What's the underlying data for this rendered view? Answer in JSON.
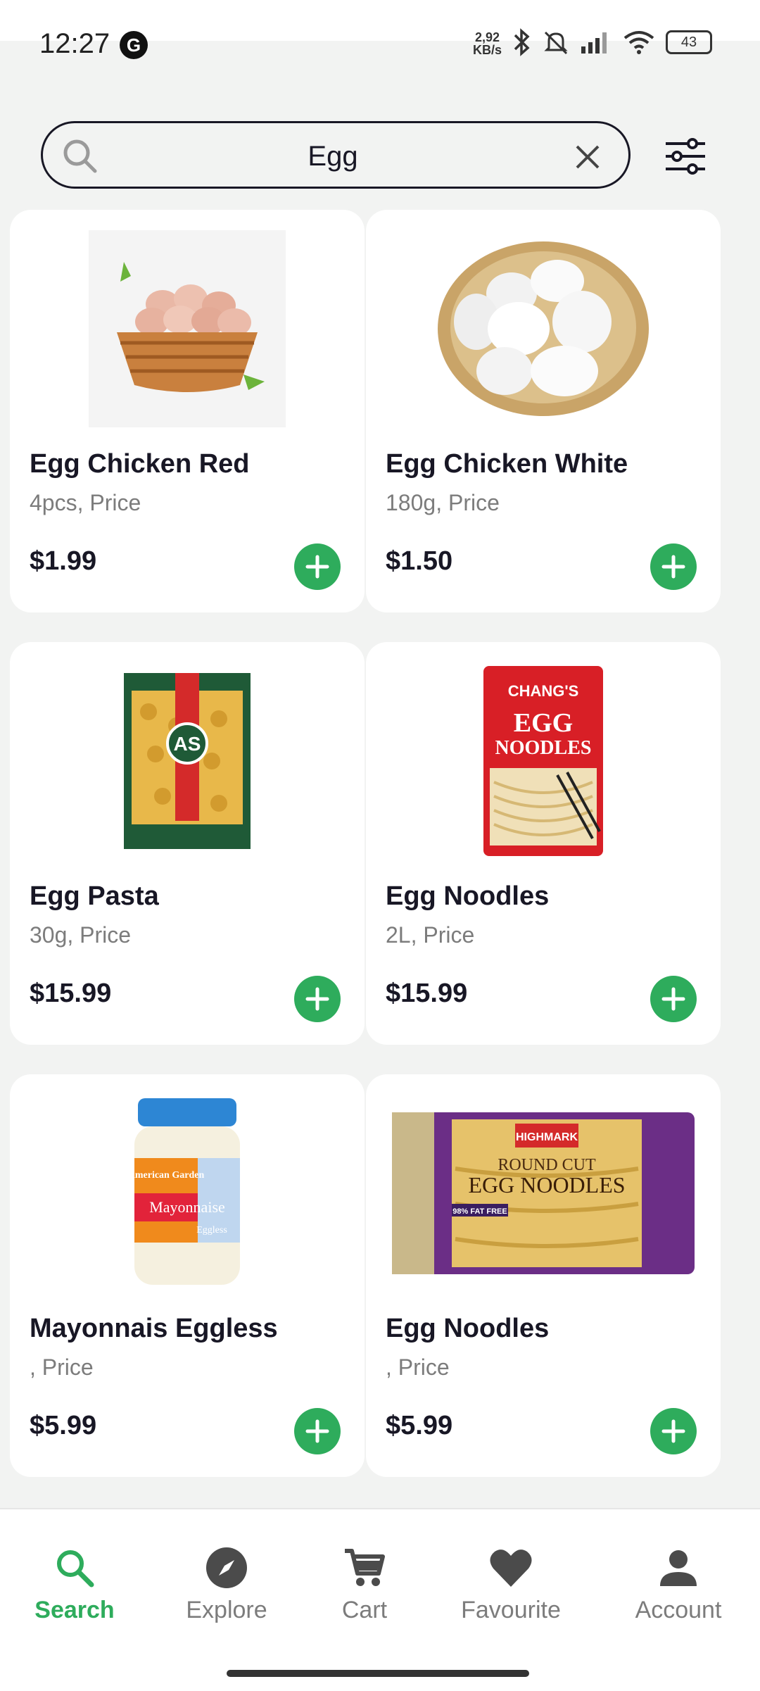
{
  "status": {
    "time": "12:27",
    "net_speed_value": "2,92",
    "net_speed_unit": "KB/s",
    "battery": "43"
  },
  "search": {
    "query": "Egg",
    "placeholder": ""
  },
  "products": [
    {
      "name": "Egg Chicken Red",
      "subtitle": "4pcs, Price",
      "price": "$1.99"
    },
    {
      "name": "Egg Chicken White",
      "subtitle": "180g, Price",
      "price": "$1.50"
    },
    {
      "name": "Egg Pasta",
      "subtitle": "30g, Price",
      "price": "$15.99"
    },
    {
      "name": "Egg Noodles",
      "subtitle": "2L, Price",
      "price": "$15.99"
    },
    {
      "name": "Mayonnais Eggless",
      "subtitle": ", Price",
      "price": "$5.99"
    },
    {
      "name": "Egg Noodles",
      "subtitle": ", Price",
      "price": "$5.99"
    }
  ],
  "product_art": {
    "noodle_brand": "CHANG'S",
    "noodle_title_1": "EGG",
    "noodle_title_2": "NOODLES",
    "mayo_brand": "American Garden",
    "mayo_label": "Mayonnaise",
    "mayo_sub": "Eggless",
    "hm_brand": "HIGHMARK",
    "hm_title_1": "ROUND CUT",
    "hm_title_2": "EGG NOODLES",
    "hm_badge": "98% FAT FREE"
  },
  "nav": {
    "items": [
      {
        "label": "Search",
        "icon": "search-icon",
        "active": true
      },
      {
        "label": "Explore",
        "icon": "compass-icon",
        "active": false
      },
      {
        "label": "Cart",
        "icon": "cart-icon",
        "active": false
      },
      {
        "label": "Favourite",
        "icon": "heart-icon",
        "active": false
      },
      {
        "label": "Account",
        "icon": "person-icon",
        "active": false
      }
    ]
  },
  "colors": {
    "accent": "#2eac5c",
    "text_primary": "#181725",
    "text_secondary": "#7c7c7c"
  }
}
